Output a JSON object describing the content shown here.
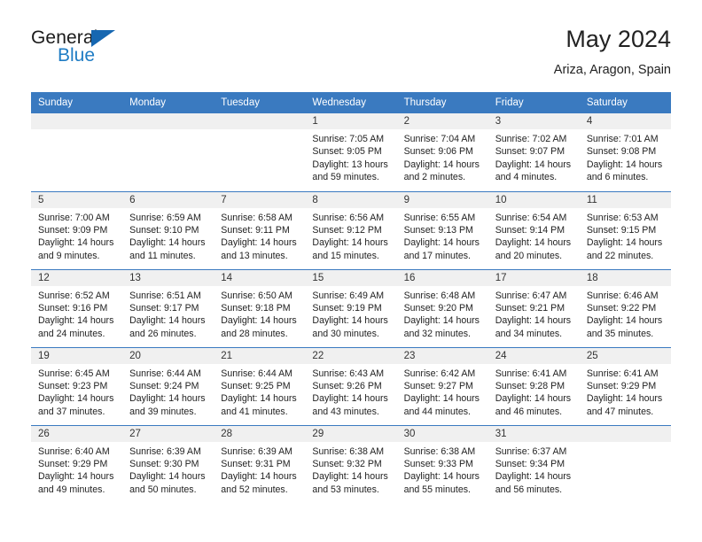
{
  "brand": {
    "name_top": "General",
    "name_bottom": "Blue",
    "flag_icon": "blue-triangle-flag",
    "accent_color": "#1667b1",
    "text_color": "#1f7cc4"
  },
  "header": {
    "title": "May 2024",
    "subtitle": "Ariza, Aragon, Spain"
  },
  "theme": {
    "header_blue": "#3a7ac0",
    "daynum_gray": "#f0f0f0",
    "text": "#222222"
  },
  "weekdays": [
    "Sunday",
    "Monday",
    "Tuesday",
    "Wednesday",
    "Thursday",
    "Friday",
    "Saturday"
  ],
  "labels": {
    "sunrise_prefix": "Sunrise:",
    "sunset_prefix": "Sunset:",
    "daylight_prefix": "Daylight:"
  },
  "weeks": [
    [
      {
        "day": "",
        "empty": true
      },
      {
        "day": "",
        "empty": true
      },
      {
        "day": "",
        "empty": true
      },
      {
        "day": "1",
        "sunrise": "Sunrise: 7:05 AM",
        "sunset": "Sunset: 9:05 PM",
        "daylight_l1": "Daylight: 13 hours",
        "daylight_l2": "and 59 minutes."
      },
      {
        "day": "2",
        "sunrise": "Sunrise: 7:04 AM",
        "sunset": "Sunset: 9:06 PM",
        "daylight_l1": "Daylight: 14 hours",
        "daylight_l2": "and 2 minutes."
      },
      {
        "day": "3",
        "sunrise": "Sunrise: 7:02 AM",
        "sunset": "Sunset: 9:07 PM",
        "daylight_l1": "Daylight: 14 hours",
        "daylight_l2": "and 4 minutes."
      },
      {
        "day": "4",
        "sunrise": "Sunrise: 7:01 AM",
        "sunset": "Sunset: 9:08 PM",
        "daylight_l1": "Daylight: 14 hours",
        "daylight_l2": "and 6 minutes."
      }
    ],
    [
      {
        "day": "5",
        "sunrise": "Sunrise: 7:00 AM",
        "sunset": "Sunset: 9:09 PM",
        "daylight_l1": "Daylight: 14 hours",
        "daylight_l2": "and 9 minutes."
      },
      {
        "day": "6",
        "sunrise": "Sunrise: 6:59 AM",
        "sunset": "Sunset: 9:10 PM",
        "daylight_l1": "Daylight: 14 hours",
        "daylight_l2": "and 11 minutes."
      },
      {
        "day": "7",
        "sunrise": "Sunrise: 6:58 AM",
        "sunset": "Sunset: 9:11 PM",
        "daylight_l1": "Daylight: 14 hours",
        "daylight_l2": "and 13 minutes."
      },
      {
        "day": "8",
        "sunrise": "Sunrise: 6:56 AM",
        "sunset": "Sunset: 9:12 PM",
        "daylight_l1": "Daylight: 14 hours",
        "daylight_l2": "and 15 minutes."
      },
      {
        "day": "9",
        "sunrise": "Sunrise: 6:55 AM",
        "sunset": "Sunset: 9:13 PM",
        "daylight_l1": "Daylight: 14 hours",
        "daylight_l2": "and 17 minutes."
      },
      {
        "day": "10",
        "sunrise": "Sunrise: 6:54 AM",
        "sunset": "Sunset: 9:14 PM",
        "daylight_l1": "Daylight: 14 hours",
        "daylight_l2": "and 20 minutes."
      },
      {
        "day": "11",
        "sunrise": "Sunrise: 6:53 AM",
        "sunset": "Sunset: 9:15 PM",
        "daylight_l1": "Daylight: 14 hours",
        "daylight_l2": "and 22 minutes."
      }
    ],
    [
      {
        "day": "12",
        "sunrise": "Sunrise: 6:52 AM",
        "sunset": "Sunset: 9:16 PM",
        "daylight_l1": "Daylight: 14 hours",
        "daylight_l2": "and 24 minutes."
      },
      {
        "day": "13",
        "sunrise": "Sunrise: 6:51 AM",
        "sunset": "Sunset: 9:17 PM",
        "daylight_l1": "Daylight: 14 hours",
        "daylight_l2": "and 26 minutes."
      },
      {
        "day": "14",
        "sunrise": "Sunrise: 6:50 AM",
        "sunset": "Sunset: 9:18 PM",
        "daylight_l1": "Daylight: 14 hours",
        "daylight_l2": "and 28 minutes."
      },
      {
        "day": "15",
        "sunrise": "Sunrise: 6:49 AM",
        "sunset": "Sunset: 9:19 PM",
        "daylight_l1": "Daylight: 14 hours",
        "daylight_l2": "and 30 minutes."
      },
      {
        "day": "16",
        "sunrise": "Sunrise: 6:48 AM",
        "sunset": "Sunset: 9:20 PM",
        "daylight_l1": "Daylight: 14 hours",
        "daylight_l2": "and 32 minutes."
      },
      {
        "day": "17",
        "sunrise": "Sunrise: 6:47 AM",
        "sunset": "Sunset: 9:21 PM",
        "daylight_l1": "Daylight: 14 hours",
        "daylight_l2": "and 34 minutes."
      },
      {
        "day": "18",
        "sunrise": "Sunrise: 6:46 AM",
        "sunset": "Sunset: 9:22 PM",
        "daylight_l1": "Daylight: 14 hours",
        "daylight_l2": "and 35 minutes."
      }
    ],
    [
      {
        "day": "19",
        "sunrise": "Sunrise: 6:45 AM",
        "sunset": "Sunset: 9:23 PM",
        "daylight_l1": "Daylight: 14 hours",
        "daylight_l2": "and 37 minutes."
      },
      {
        "day": "20",
        "sunrise": "Sunrise: 6:44 AM",
        "sunset": "Sunset: 9:24 PM",
        "daylight_l1": "Daylight: 14 hours",
        "daylight_l2": "and 39 minutes."
      },
      {
        "day": "21",
        "sunrise": "Sunrise: 6:44 AM",
        "sunset": "Sunset: 9:25 PM",
        "daylight_l1": "Daylight: 14 hours",
        "daylight_l2": "and 41 minutes."
      },
      {
        "day": "22",
        "sunrise": "Sunrise: 6:43 AM",
        "sunset": "Sunset: 9:26 PM",
        "daylight_l1": "Daylight: 14 hours",
        "daylight_l2": "and 43 minutes."
      },
      {
        "day": "23",
        "sunrise": "Sunrise: 6:42 AM",
        "sunset": "Sunset: 9:27 PM",
        "daylight_l1": "Daylight: 14 hours",
        "daylight_l2": "and 44 minutes."
      },
      {
        "day": "24",
        "sunrise": "Sunrise: 6:41 AM",
        "sunset": "Sunset: 9:28 PM",
        "daylight_l1": "Daylight: 14 hours",
        "daylight_l2": "and 46 minutes."
      },
      {
        "day": "25",
        "sunrise": "Sunrise: 6:41 AM",
        "sunset": "Sunset: 9:29 PM",
        "daylight_l1": "Daylight: 14 hours",
        "daylight_l2": "and 47 minutes."
      }
    ],
    [
      {
        "day": "26",
        "sunrise": "Sunrise: 6:40 AM",
        "sunset": "Sunset: 9:29 PM",
        "daylight_l1": "Daylight: 14 hours",
        "daylight_l2": "and 49 minutes."
      },
      {
        "day": "27",
        "sunrise": "Sunrise: 6:39 AM",
        "sunset": "Sunset: 9:30 PM",
        "daylight_l1": "Daylight: 14 hours",
        "daylight_l2": "and 50 minutes."
      },
      {
        "day": "28",
        "sunrise": "Sunrise: 6:39 AM",
        "sunset": "Sunset: 9:31 PM",
        "daylight_l1": "Daylight: 14 hours",
        "daylight_l2": "and 52 minutes."
      },
      {
        "day": "29",
        "sunrise": "Sunrise: 6:38 AM",
        "sunset": "Sunset: 9:32 PM",
        "daylight_l1": "Daylight: 14 hours",
        "daylight_l2": "and 53 minutes."
      },
      {
        "day": "30",
        "sunrise": "Sunrise: 6:38 AM",
        "sunset": "Sunset: 9:33 PM",
        "daylight_l1": "Daylight: 14 hours",
        "daylight_l2": "and 55 minutes."
      },
      {
        "day": "31",
        "sunrise": "Sunrise: 6:37 AM",
        "sunset": "Sunset: 9:34 PM",
        "daylight_l1": "Daylight: 14 hours",
        "daylight_l2": "and 56 minutes."
      },
      {
        "day": "",
        "empty": true
      }
    ]
  ]
}
